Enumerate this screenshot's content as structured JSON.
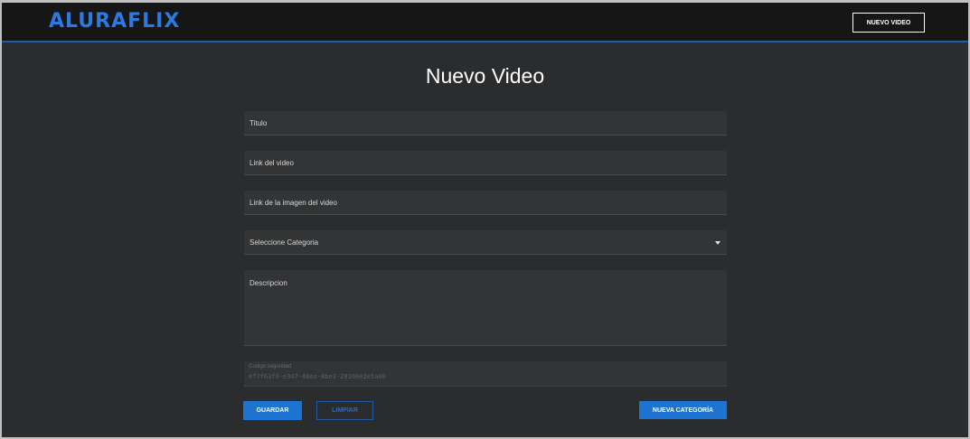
{
  "header": {
    "logo": "ALURAFLIX",
    "new_video_button": "NUEVO VIDEO"
  },
  "page": {
    "title": "Nuevo Video"
  },
  "form": {
    "titulo_label": "Titulo",
    "link_video_label": "Link del video",
    "link_imagen_label": "Link de la imagen del video",
    "categoria_label": "Seleccione Categoria",
    "descripcion_label": "Descripcion",
    "codigo_label": "Codigo seguridad",
    "codigo_value": "ef7f63f9-e347-48ea-8be3-29100e2e5a00"
  },
  "actions": {
    "guardar": "GUARDAR",
    "limpiar": "LIMPIAR",
    "nueva_categoria": "NUEVA CATEGORÍA"
  },
  "colors": {
    "accent": "#1c73d1",
    "logo": "#2a7ae2",
    "background": "#2b2c2e",
    "header": "#161616"
  }
}
